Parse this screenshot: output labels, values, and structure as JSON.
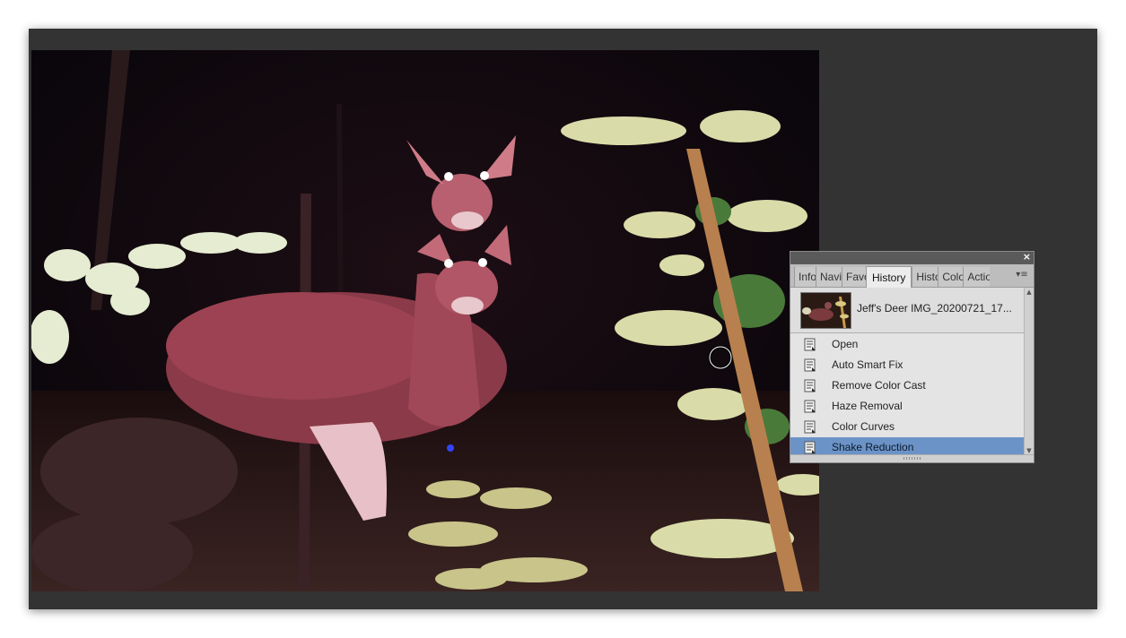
{
  "panel": {
    "close_glyph": "×",
    "menu_glyph": "▾≡",
    "tabs": [
      {
        "label": "Info",
        "width": 24
      },
      {
        "label": "Navigator",
        "width": 29
      },
      {
        "label": "Favorites",
        "width": 27
      },
      {
        "label": "History",
        "active": true
      },
      {
        "label": "Histogram",
        "width": 29
      },
      {
        "label": "Color",
        "width": 28
      },
      {
        "label": "Actions",
        "width": 30
      }
    ],
    "snapshot_label": "Jeff's Deer IMG_20200721_17...",
    "states": [
      {
        "label": "Open",
        "selected": false
      },
      {
        "label": "Auto Smart Fix",
        "selected": false
      },
      {
        "label": "Remove Color Cast",
        "selected": false
      },
      {
        "label": "Haze Removal",
        "selected": false
      },
      {
        "label": "Color Curves",
        "selected": false
      },
      {
        "label": "Shake Reduction",
        "selected": true
      }
    ],
    "colors": {
      "selected_row": "#6b93c8",
      "panel_bg": "#e4e4e4",
      "workspace_bg": "#333333"
    }
  },
  "icons": {
    "state": "history-state-icon",
    "close": "close-icon",
    "menu": "panel-menu-icon",
    "cursor": "brush-cursor-icon"
  }
}
